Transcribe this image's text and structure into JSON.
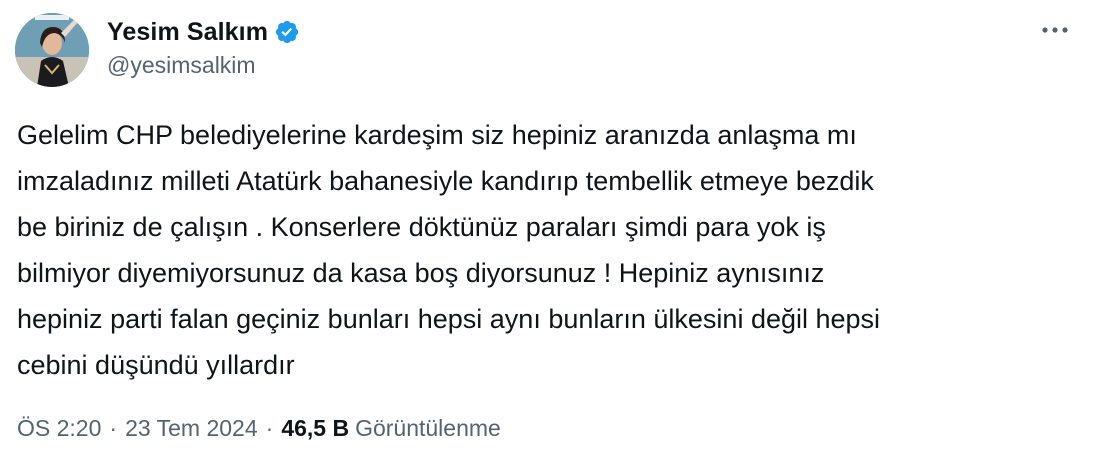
{
  "author": {
    "display_name": "Yesim Salkım",
    "handle": "@yesimsalkim",
    "verified": true
  },
  "tweet": {
    "text": "Gelelim CHP belediyelerine kardeşim siz hepiniz aranızda anlaşma mı\nimzaladınız milleti Atatürk bahanesiyle kandırıp tembellik etmeye bezdik\nbe biriniz de çalışın . Konserlere döktünüz paraları şimdi para yok iş\nbilmiyor diyemiyorsunuz da kasa boş diyorsunuz ! Hepiniz aynısınız\nhepiniz parti falan geçiniz bunları hepsi aynı bunların ülkesini değil hepsi\ncebini düşündü yıllardır"
  },
  "meta": {
    "time": "ÖS 2:20",
    "separator": "·",
    "date": "23 Tem 2024",
    "views_count": "46,5 B",
    "views_label": "Görüntülenme"
  },
  "icons": {
    "verified": "verified-badge-icon",
    "more": "more-options-icon"
  },
  "colors": {
    "verified": "#1d9bf0",
    "secondary_text": "#536471",
    "primary_text": "#0f1419"
  }
}
